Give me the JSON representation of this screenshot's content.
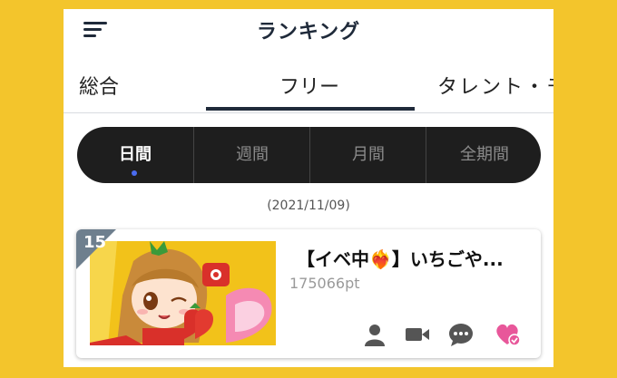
{
  "header": {
    "title": "ランキング",
    "menu_icon": "hamburger-icon"
  },
  "tabs": [
    {
      "label": "総合",
      "active": false
    },
    {
      "label": "フリー",
      "active": true
    },
    {
      "label": "タレント・モ",
      "active": false
    }
  ],
  "periods": [
    {
      "label": "日間",
      "active": true
    },
    {
      "label": "週間",
      "active": false
    },
    {
      "label": "月間",
      "active": false
    },
    {
      "label": "全期間",
      "active": false
    }
  ],
  "date": "(2021/11/09)",
  "room": {
    "rank": "15",
    "title": "【イベ中❤️‍🔥】いちごや...",
    "points": "175066pt",
    "icons": [
      "person-icon",
      "video-camera-icon",
      "chat-bubble-icon",
      "heart-check-icon"
    ]
  },
  "colors": {
    "background": "#f3c52c",
    "dark": "#1e1e1e",
    "accent_dot": "#4a6cf0",
    "heart": "#e8579a",
    "rank_badge": "#6e7f8e"
  }
}
